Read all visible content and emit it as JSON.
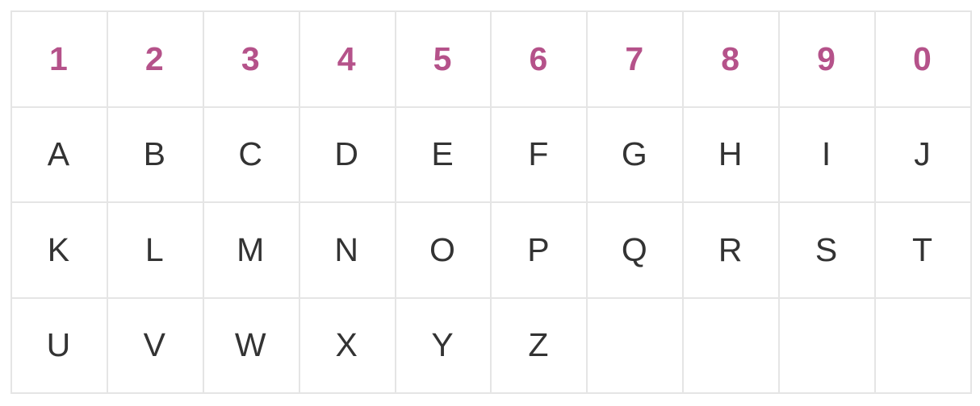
{
  "accent_color": "#b5528a",
  "text_color": "#333333",
  "grid_line_color": "#e5e5e5",
  "rows": [
    [
      "1",
      "2",
      "3",
      "4",
      "5",
      "6",
      "7",
      "8",
      "9",
      "0"
    ],
    [
      "A",
      "B",
      "C",
      "D",
      "E",
      "F",
      "G",
      "H",
      "I",
      "J"
    ],
    [
      "K",
      "L",
      "M",
      "N",
      "O",
      "P",
      "Q",
      "R",
      "S",
      "T"
    ],
    [
      "U",
      "V",
      "W",
      "X",
      "Y",
      "Z",
      "",
      "",
      "",
      ""
    ]
  ]
}
